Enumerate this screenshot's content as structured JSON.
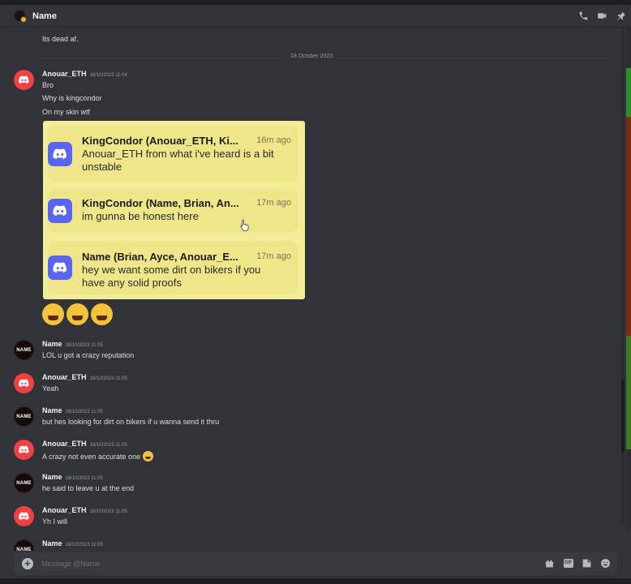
{
  "window": {
    "title": "Name"
  },
  "header_icons": [
    "phone-call-icon",
    "video-call-icon",
    "pin-icon"
  ],
  "top_message": "Its dead af.",
  "date_divider": "18 October 2023",
  "first_block": {
    "author": "Anouar_ETH",
    "timestamp": "18/10/2023 11:04",
    "lines": [
      "Bro",
      "Why is kingcondor",
      "On my skin wtf"
    ]
  },
  "notifications": [
    {
      "title": "KingCondor (Anouar_ETH, Ki...",
      "time": "16m ago",
      "body": "Anouar_ETH from what i've heard is a bit unstable"
    },
    {
      "title": "KingCondor (Name, Brian, An...",
      "time": "17m ago",
      "body": "im gunna be honest here"
    },
    {
      "title": "Name (Brian, Ayce, Anouar_E...",
      "time": "17m ago",
      "body": "hey we want some dirt on bikers if you have any solid proofs"
    }
  ],
  "reaction_emojis": "😂😂😂",
  "messages": [
    {
      "author": "Name",
      "timestamp": "18/10/2023 11:05",
      "text": "LOL u got a crazy reputation",
      "avatar": "name"
    },
    {
      "author": "Anouar_ETH",
      "timestamp": "18/10/2023 11:05",
      "text": "Yeah",
      "avatar": "discord"
    },
    {
      "author": "Name",
      "timestamp": "18/10/2023 11:05",
      "text": "but hes looking for dirt on bikers if u wanna send it thru",
      "avatar": "name"
    },
    {
      "author": "Anouar_ETH",
      "timestamp": "18/10/2023 11:05",
      "text": "A crazy not even accurate one",
      "avatar": "discord"
    },
    {
      "author": "Name",
      "timestamp": "18/10/2023 11:05",
      "text": "he said to leave u at the end",
      "avatar": "name"
    },
    {
      "author": "Anouar_ETH",
      "timestamp": "18/10/2023 11:05",
      "text": "Yh I will",
      "avatar": "discord"
    },
    {
      "author": "Name",
      "timestamp": "18/10/2023 11:05",
      "text": "",
      "avatar": "name"
    }
  ],
  "avatar_label": "NAME",
  "composer": {
    "placeholder": "Message @Name"
  },
  "composer_icons": [
    "gift-icon",
    "gif-icon",
    "sticker-icon",
    "emoji-icon"
  ],
  "gif_label": "GIF",
  "colors": {
    "background": "#313338",
    "accent_red": "#f23f43",
    "blurple": "#5865f2",
    "notification_bg": "#f3ed9a"
  }
}
